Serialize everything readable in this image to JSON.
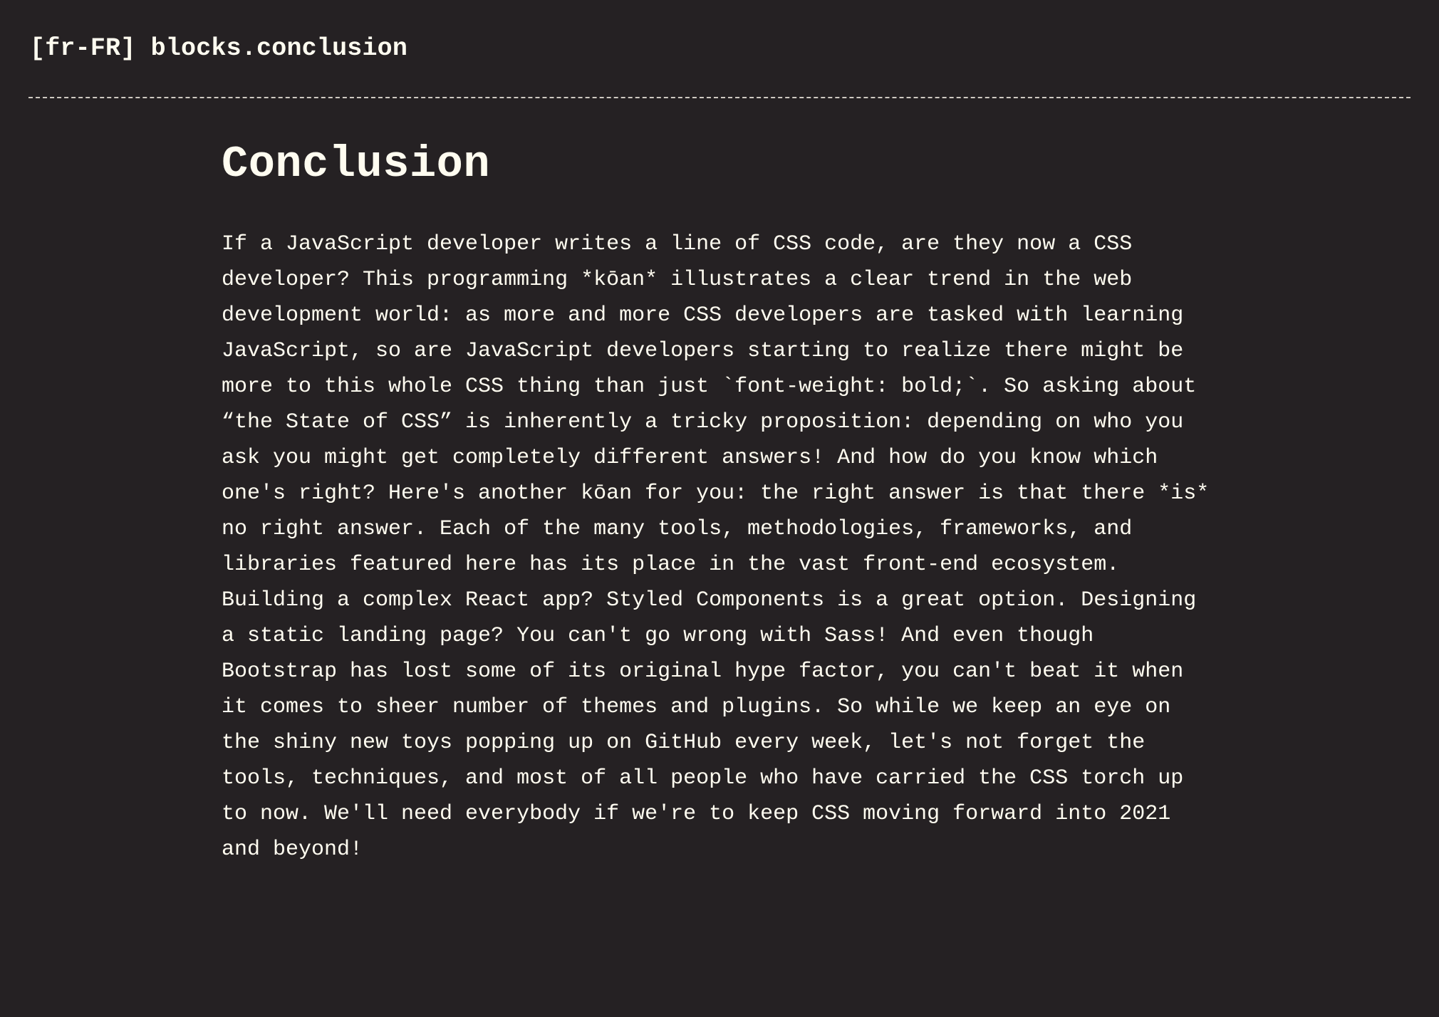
{
  "header": {
    "block_id": "[fr-FR] blocks.conclusion"
  },
  "main": {
    "heading": "Conclusion",
    "body": "If a JavaScript developer writes a line of CSS code, are they now a CSS\ndeveloper? This programming *kōan* illustrates a clear trend in the web\ndevelopment world: as more and more CSS developers are tasked with learning\nJavaScript, so are JavaScript developers starting to realize there might be\nmore to this whole CSS thing than just `font-weight: bold;`. So asking about\n“the State of CSS” is inherently a tricky proposition: depending on who you\nask you might get completely different answers! And how do you know which\none's right? Here's another kōan for you: the right answer is that there *is*\nno right answer. Each of the many tools, methodologies, frameworks, and\nlibraries featured here has its place in the vast front-end ecosystem.\nBuilding a complex React app? Styled Components is a great option. Designing\na static landing page? You can't go wrong with Sass! And even though\nBootstrap has lost some of its original hype factor, you can't beat it when\nit comes to sheer number of themes and plugins. So while we keep an eye on\nthe shiny new toys popping up on GitHub every week, let's not forget the\ntools, techniques, and most of all people who have carried the CSS torch up\nto now. We'll need everybody if we're to keep CSS moving forward into 2021\nand beyond!"
  },
  "colors": {
    "background": "#252123",
    "text": "#fffcf0",
    "divider": "#cfcac2"
  }
}
